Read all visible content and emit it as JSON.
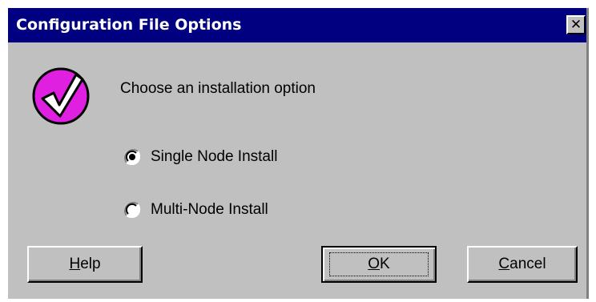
{
  "window": {
    "title": "Configuration File Options",
    "close_glyph": "✕"
  },
  "prompt": "Choose an installation option",
  "icon": "checkmark-icon",
  "options": [
    {
      "label": "Single Node Install",
      "selected": true
    },
    {
      "label": "Multi-Node Install",
      "selected": false
    }
  ],
  "buttons": {
    "help": {
      "mnemonic": "H",
      "rest": "elp"
    },
    "ok": {
      "mnemonic": "O",
      "rest": "K"
    },
    "cancel": {
      "mnemonic": "C",
      "rest": "ancel"
    }
  },
  "colors": {
    "titlebar": "#000080",
    "dialog_face": "#c0c0c0",
    "icon_fill": "#e020e0"
  }
}
